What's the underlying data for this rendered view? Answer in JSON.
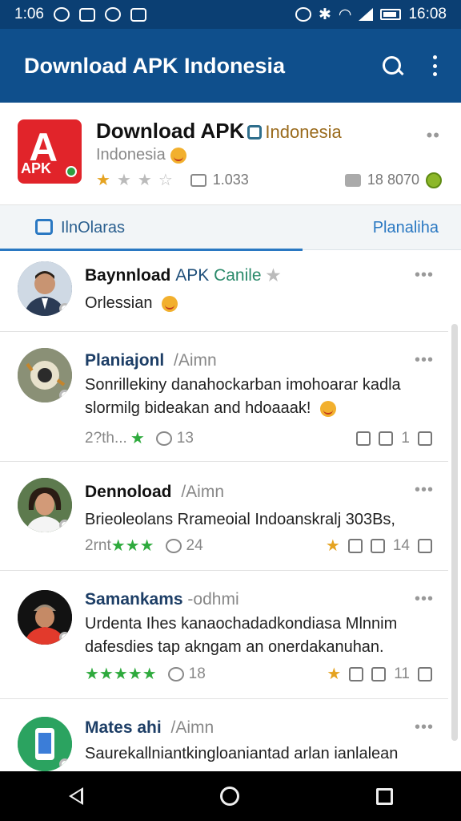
{
  "status_bar": {
    "time_left": "1:06",
    "time_right": "16:08"
  },
  "app_bar": {
    "title": "Download APK Indonesia",
    "search_icon": "search-icon",
    "more_icon": "more-vert-icon"
  },
  "header": {
    "title": "Download APK",
    "title_suffix": "Indonesia",
    "subtitle": "Indonesia",
    "rating_stars": 1,
    "rating_max": 4,
    "count_left": "1.033",
    "count_right": "18 8070",
    "more": "••"
  },
  "tabs": {
    "left_label": "IlnOlaras",
    "right_label": "Planaliha"
  },
  "posts": [
    {
      "name": "Baynnload",
      "app": "APK",
      "highlight": "Canile",
      "text": "Orlessian",
      "more": "•••"
    },
    {
      "name": "Planiajonl",
      "handle": "/Aimn",
      "text": "Sonrillekiny danahockarban imohoarar kadla slormilg bideakan and hdoaaak!",
      "time": "2?th...",
      "comments": "13",
      "reposts": "1",
      "more": "•••"
    },
    {
      "name": "Dennoload",
      "handle": "/Aimn",
      "text": "Brieoleolans Rrameoial Indoanskralj 303Bs,",
      "time": "2rnt",
      "comments": "24",
      "reposts": "14",
      "more": "•••"
    },
    {
      "name": "Samankams",
      "handle": "-odhmi",
      "text": "Urdenta Ihes kanaochadadkondiasa Mlnnim dafesdies tap akngam an onerdakanuhan.",
      "comments": "18",
      "reposts": "11",
      "more": "•••"
    },
    {
      "name": "Mates ahi",
      "handle": "/Aimn",
      "text": "Saurekallniantkingloaniantad arlan ianlalean",
      "more": "•••"
    }
  ],
  "colors": {
    "status_bar": "#0b3f73",
    "app_bar": "#0f4f8c",
    "accent": "#2a78c2",
    "star_gold": "#e5a321",
    "star_green": "#2eaa3d"
  }
}
